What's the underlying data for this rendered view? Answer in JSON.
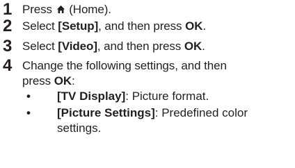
{
  "steps": [
    {
      "number": "1",
      "pre": "Press ",
      "icon": "home-icon",
      "post": " (Home)."
    },
    {
      "number": "2",
      "pre": "Select ",
      "kw1": "[Setup]",
      "mid": ", and then press ",
      "kw2": "OK",
      "post": "."
    },
    {
      "number": "3",
      "pre": "Select ",
      "kw1": "[Video]",
      "mid": ", and then press ",
      "kw2": "OK",
      "post": "."
    },
    {
      "number": "4",
      "line1": "Change the following settings, and then",
      "pre2": "press ",
      "kw": "OK",
      "post": ":"
    }
  ],
  "bullets": [
    {
      "marker": "•",
      "kw": "[TV Display]",
      "text": ": Picture format."
    },
    {
      "marker": "•",
      "kw": "[Picture Settings]",
      "text": ": Predefined color",
      "cont": "settings."
    }
  ]
}
